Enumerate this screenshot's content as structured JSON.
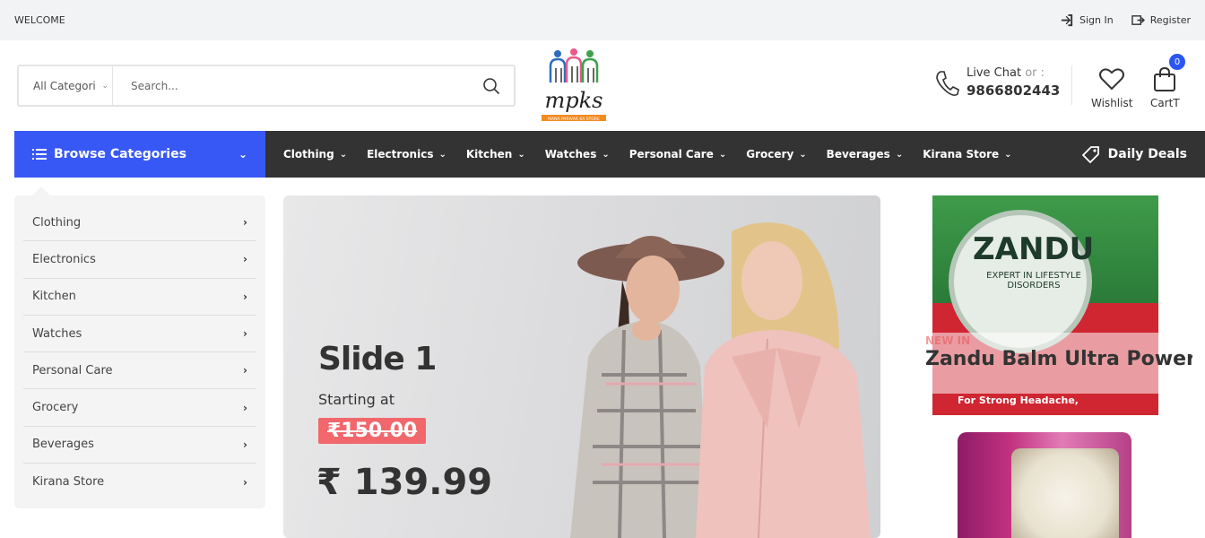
{
  "topbar": {
    "welcome": "WELCOME",
    "sign_in": "Sign In",
    "register": "Register"
  },
  "header": {
    "category_select": "All Categori",
    "search_placeholder": "Search...",
    "logo_text": "mpks",
    "logo_subtext": "MANA PARIVAR KA STORE",
    "live_chat_label": "Live Chat",
    "live_chat_or": "or :",
    "phone": "9866802443",
    "wishlist_label": "Wishlist",
    "cart_label": "CartT",
    "cart_count": "0"
  },
  "nav": {
    "browse_label": "Browse Categories",
    "items": [
      "Clothing",
      "Electronics",
      "Kitchen",
      "Watches",
      "Personal Care",
      "Grocery",
      "Beverages",
      "Kirana Store"
    ],
    "daily_deals": "Daily Deals"
  },
  "sidebar": {
    "items": [
      "Clothing",
      "Electronics",
      "Kitchen",
      "Watches",
      "Personal Care",
      "Grocery",
      "Beverages",
      "Kirana Store"
    ]
  },
  "hero": {
    "title": "Slide 1",
    "subtitle": "Starting at",
    "old_price": "₹150.00",
    "new_price": "₹ 139.99"
  },
  "promo": {
    "brand": "ZANDU",
    "tagline": "EXPERT IN LIFESTYLE DISORDERS",
    "pack_text": "For Strong Headache,",
    "badge": "NEW IN",
    "name": "Zandu Balm Ultra Power"
  },
  "colors": {
    "accent": "#3858f6",
    "nav_bg": "#333333",
    "sale": "#f1676c"
  }
}
